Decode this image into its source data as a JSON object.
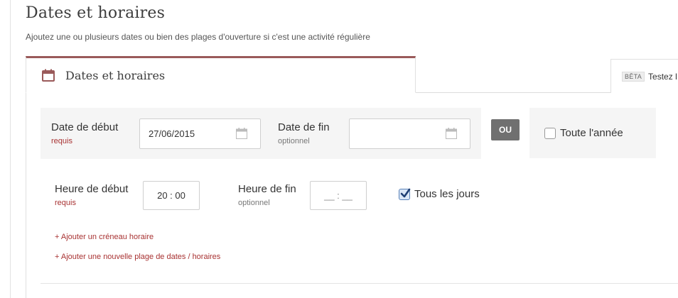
{
  "page": {
    "title": "Dates et horaires",
    "subtitle": "Ajoutez une ou plusieurs dates ou bien des plages d'ouverture si c'est une activité régulière"
  },
  "tabs": {
    "active_label": "Dates et horaires",
    "beta_badge": "BÊTA",
    "beta_label": "Testez l"
  },
  "dates": {
    "start_label": "Date de début",
    "start_hint": "requis",
    "start_value": "27/06/2015",
    "end_label": "Date de fin",
    "end_hint": "optionnel",
    "end_value": "",
    "or_label": "OU",
    "all_year_label": "Toute l'année",
    "all_year_checked": false
  },
  "times": {
    "start_label": "Heure de début",
    "start_hint": "requis",
    "start_value": "20 : 00",
    "end_label": "Heure de fin",
    "end_hint": "optionnel",
    "end_placeholder": "__ : __",
    "every_day_label": "Tous les jours",
    "every_day_checked": true
  },
  "links": {
    "add_time_slot": "+ Ajouter un créneau horaire",
    "add_date_range": "+ Ajouter une nouvelle plage de dates / horaires"
  },
  "colors": {
    "accent": "#9a5a5a",
    "required": "#a83232",
    "panel_bg": "#f5f5f5",
    "or_badge": "#707070"
  },
  "icons": {
    "tab": "calendar-icon",
    "date_inputs": "calendar-icon",
    "checkbox_checked": "checkmark-icon"
  }
}
